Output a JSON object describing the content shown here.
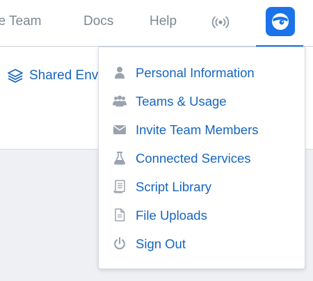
{
  "nav": {
    "invite_label": "ite Team",
    "docs_label": "Docs",
    "help_label": "Help",
    "broadcast_icon": "broadcast-icon",
    "avatar_icon": "user-avatar-icon"
  },
  "content": {
    "shared_env_label": "Shared Env",
    "shared_env_icon": "layers-icon"
  },
  "menu": {
    "items": [
      {
        "label": "Personal Information",
        "icon": "person-icon"
      },
      {
        "label": "Teams & Usage",
        "icon": "group-icon"
      },
      {
        "label": "Invite Team Members",
        "icon": "envelope-icon"
      },
      {
        "label": "Connected Services",
        "icon": "flask-icon"
      },
      {
        "label": "Script Library",
        "icon": "scroll-icon"
      },
      {
        "label": "File Uploads",
        "icon": "file-icon"
      },
      {
        "label": "Sign Out",
        "icon": "power-icon"
      }
    ]
  },
  "colors": {
    "accent": "#1a73e8",
    "link": "#1565c0",
    "nav_text": "#7d8791",
    "icon_gray": "#9aa3ad"
  }
}
